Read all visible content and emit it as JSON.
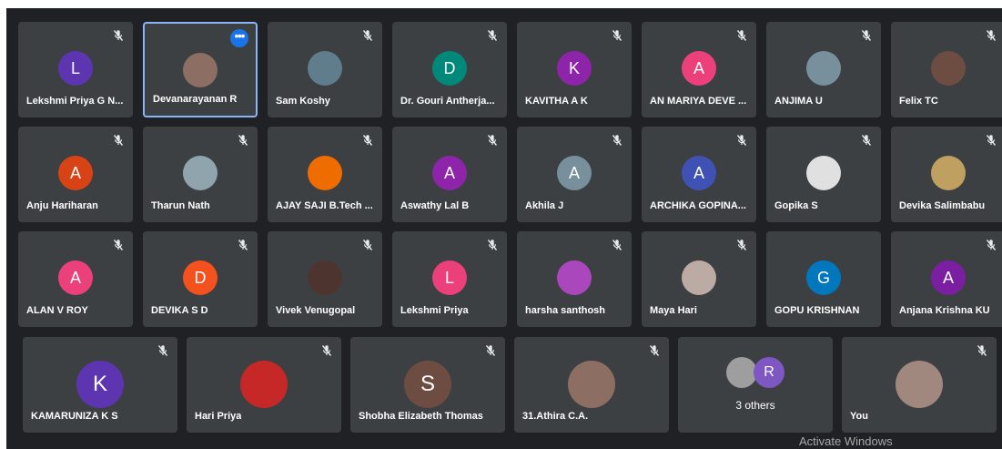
{
  "tiles": [
    {
      "name": "Lekshmi Priya G N...",
      "initial": "L",
      "color": "#5e35b1",
      "muted": true
    },
    {
      "name": "Devanarayanan R",
      "initial": "",
      "color": "#8d6e63",
      "photo": true,
      "active": true,
      "menu": "•••"
    },
    {
      "name": "Sam Koshy",
      "initial": "",
      "color": "#607d8b",
      "photo": true,
      "muted": true
    },
    {
      "name": "Dr. Gouri Antherja...",
      "initial": "D",
      "color": "#00897b",
      "muted": true
    },
    {
      "name": "KAVITHA A K",
      "initial": "K",
      "color": "#8e24aa",
      "muted": true
    },
    {
      "name": "AN MARIYA DEVE ...",
      "initial": "A",
      "color": "#ec407a",
      "muted": true
    },
    {
      "name": "ANJIMA U",
      "initial": "",
      "color": "#78909c",
      "photo": true,
      "muted": true
    },
    {
      "name": "Felix TC",
      "initial": "",
      "color": "#6d4c41",
      "photo": true,
      "muted": true
    },
    {
      "name": "Anju Hariharan",
      "initial": "A",
      "color": "#d84315",
      "muted": true
    },
    {
      "name": "Tharun Nath",
      "initial": "",
      "color": "#90a4ae",
      "photo": true,
      "muted": true
    },
    {
      "name": "AJAY SAJI B.Tech ...",
      "initial": "",
      "color": "#ef6c00",
      "photo": true,
      "muted": true
    },
    {
      "name": "Aswathy Lal B",
      "initial": "A",
      "color": "#8e24aa",
      "muted": true
    },
    {
      "name": "Akhila J",
      "initial": "A",
      "color": "#78909c",
      "muted": true
    },
    {
      "name": "ARCHIKA GOPINA...",
      "initial": "A",
      "color": "#3f51b5",
      "muted": true
    },
    {
      "name": "Gopika S",
      "initial": "",
      "color": "#e0e0e0",
      "photo": true,
      "muted": true
    },
    {
      "name": "Devika Salimbabu",
      "initial": "",
      "color": "#c0a060",
      "photo": true,
      "muted": true
    },
    {
      "name": "ALAN V ROY",
      "initial": "A",
      "color": "#ec407a",
      "muted": true
    },
    {
      "name": "DEVIKA S D",
      "initial": "D",
      "color": "#f4511e",
      "muted": true
    },
    {
      "name": "Vivek Venugopal",
      "initial": "",
      "color": "#4e342e",
      "photo": true,
      "muted": true
    },
    {
      "name": "Lekshmi Priya",
      "initial": "L",
      "color": "#ec407a",
      "muted": true
    },
    {
      "name": "harsha santhosh",
      "initial": "",
      "color": "#ab47bc",
      "photo": true,
      "muted": true
    },
    {
      "name": "Maya Hari",
      "initial": "",
      "color": "#bcaaa4",
      "photo": true,
      "muted": true
    },
    {
      "name": "GOPU KRISHNAN",
      "initial": "G",
      "color": "#0277bd",
      "muted": false
    },
    {
      "name": "Anjana Krishna KU",
      "initial": "A",
      "color": "#7b1fa2",
      "muted": true
    },
    {
      "name": "KAMARUNIZA K S",
      "initial": "K",
      "color": "#5e35b1",
      "muted": true
    },
    {
      "name": "Hari Priya",
      "initial": "",
      "color": "#c62828",
      "photo": true,
      "muted": true
    },
    {
      "name": "Shobha Elizabeth Thomas",
      "initial": "S",
      "color": "#6d4c41",
      "muted": true
    },
    {
      "name": "31.Athira C.A.",
      "initial": "",
      "color": "#8d6e63",
      "photo": true,
      "muted": true
    },
    {
      "name": "",
      "others": true,
      "label": "3 others",
      "initial": "R",
      "color": "#7e57c2",
      "photo_color": "#9e9e9e"
    },
    {
      "name": "You",
      "initial": "",
      "color": "#a1887f",
      "photo": true,
      "muted": true
    }
  ],
  "watermark": "Activate Windows"
}
